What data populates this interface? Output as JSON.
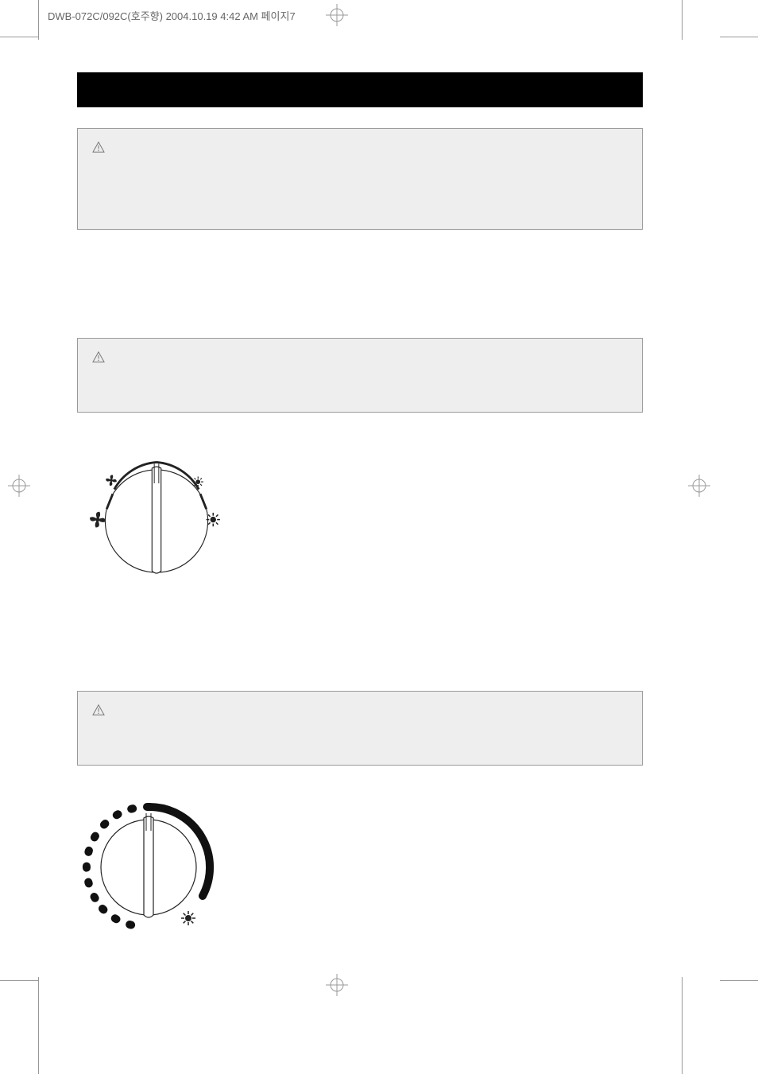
{
  "header": "DWB-072C/092C(호주향)  2004.10.19 4:42 AM  페이지7"
}
